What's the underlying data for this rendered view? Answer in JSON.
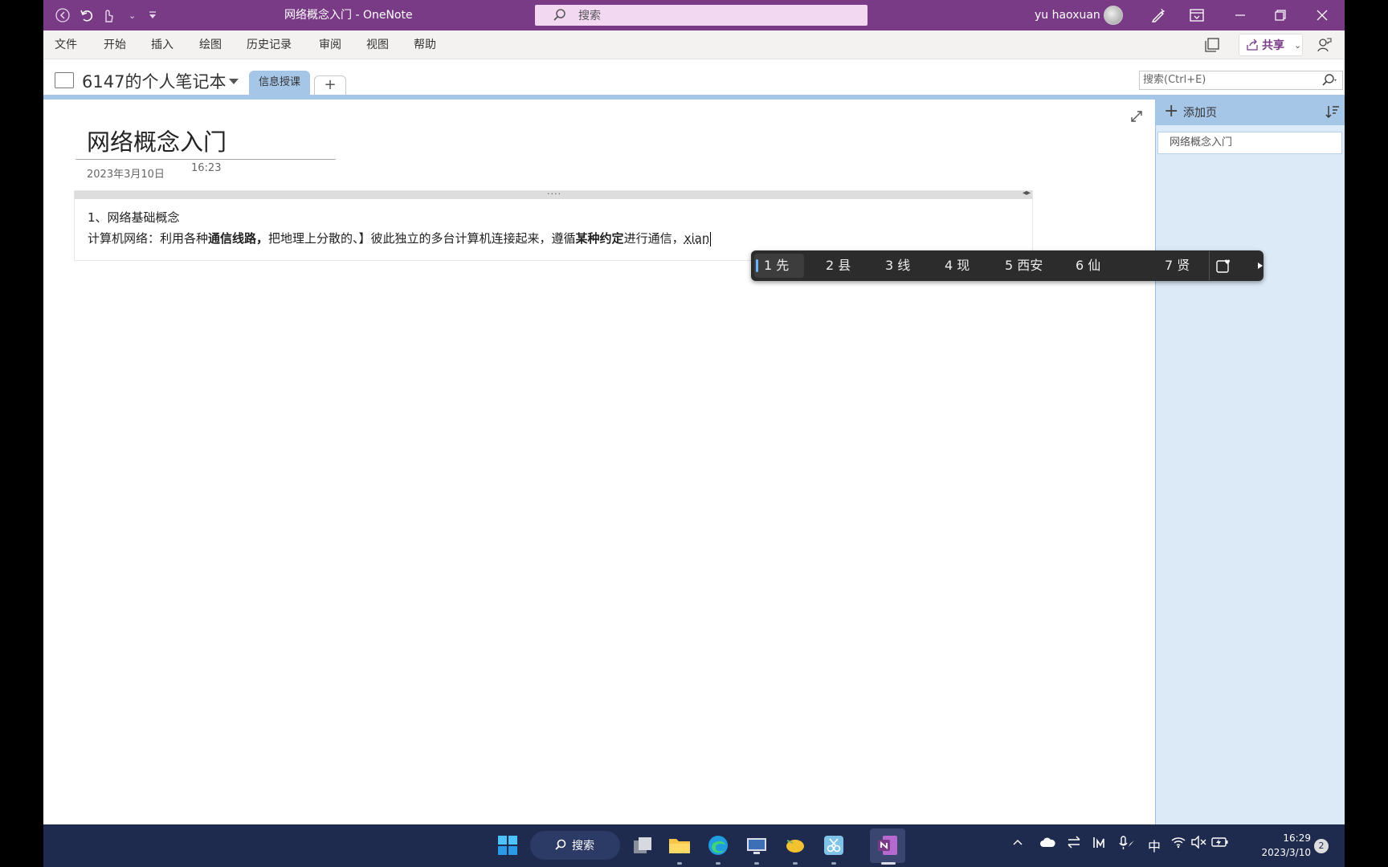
{
  "window": {
    "title": "网络概念入门 - OneNote",
    "search_placeholder": "搜索",
    "user_name": "yu haoxuan"
  },
  "menu": {
    "items": [
      "文件",
      "开始",
      "插入",
      "绘图",
      "历史记录",
      "审阅",
      "视图",
      "帮助"
    ],
    "share_label": "共享"
  },
  "notebook": {
    "name": "6147的个人笔记本",
    "section_tab": "信息授课",
    "add_tab": "+",
    "page_search_placeholder": "搜索(Ctrl+E)"
  },
  "page": {
    "title": "网络概念入门",
    "date": "2023年3月10日",
    "time": "16:23",
    "line1": "1、网络基础概念",
    "line2_parts": [
      "计算机网络：利用各种",
      "通信线路，",
      "把地理上分散的、】彼此独立的多台计算机连接起来，遵循",
      "某种约定",
      "进行通信，",
      "xian"
    ]
  },
  "page_pane": {
    "add_page_label": "添加页",
    "pages": [
      "网络概念入门"
    ]
  },
  "ime": {
    "candidates": [
      "1 先",
      "2 县",
      "3 线",
      "4 现",
      "5 西安",
      "6 仙",
      "7 贤"
    ]
  },
  "taskbar": {
    "search_label": "搜索",
    "ime_indicator": "中",
    "time": "16:29",
    "date": "2023/3/10",
    "notification_count": "2"
  },
  "colors": {
    "onenote_purple": "#7a3b86",
    "section_blue": "#a6c6e8",
    "taskbar": "#1f2a4f"
  }
}
